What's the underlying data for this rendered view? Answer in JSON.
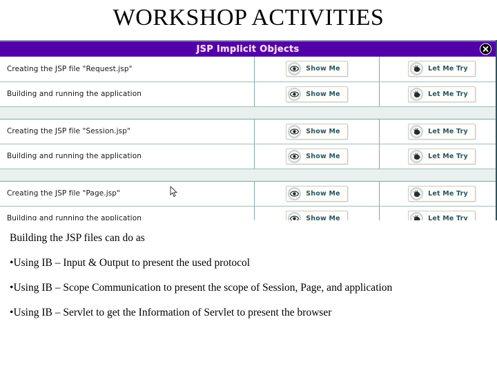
{
  "slide": {
    "title": "WORKSHOP ACTIVITIES"
  },
  "app_window": {
    "titlebar": {
      "title": "JSP Implicit Objects",
      "close_icon": "close-x-icon"
    },
    "columns": {
      "description": "",
      "show": "",
      "try": ""
    },
    "button_labels": {
      "show": "Show Me",
      "try": "Let Me Try"
    },
    "icons": {
      "show": "eye-icon",
      "try": "hand-pointer-icon"
    },
    "groups": [
      {
        "rows": [
          {
            "desc": "Creating the JSP file \"Request.jsp\"",
            "show": "Show Me",
            "try": "Let Me Try"
          },
          {
            "desc": "Building and running the application",
            "show": "Show Me",
            "try": "Let Me Try"
          }
        ]
      },
      {
        "rows": [
          {
            "desc": "Creating the JSP file \"Session.jsp\"",
            "show": "Show Me",
            "try": "Let Me Try"
          },
          {
            "desc": "Building and running the application",
            "show": "Show Me",
            "try": "Let Me Try"
          }
        ]
      },
      {
        "rows": [
          {
            "desc": "Creating the JSP file \"Page.jsp\"",
            "show": "Show Me",
            "try": "Let Me Try"
          },
          {
            "desc": "Building and running the application",
            "show": "Show Me",
            "try": "Let Me Try"
          }
        ]
      }
    ]
  },
  "body": {
    "heading": "Building the JSP files can do as",
    "bullets": [
      "Using IB – Input & Output to present the used protocol",
      "Using IB – Scope Communication to present the scope of Session, Page, and application",
      "Using IB – Servlet to get the Information of Servlet to present the browser"
    ],
    "bullet_marker": "•"
  },
  "colors": {
    "titlebar_purple": "#5200a8",
    "titlebar_text": "#f2e2f2",
    "table_border": "#9dbcbc",
    "gap_row": "#e9f0ee",
    "button_text": "#2b5560",
    "window_edge": "#2b5560"
  }
}
